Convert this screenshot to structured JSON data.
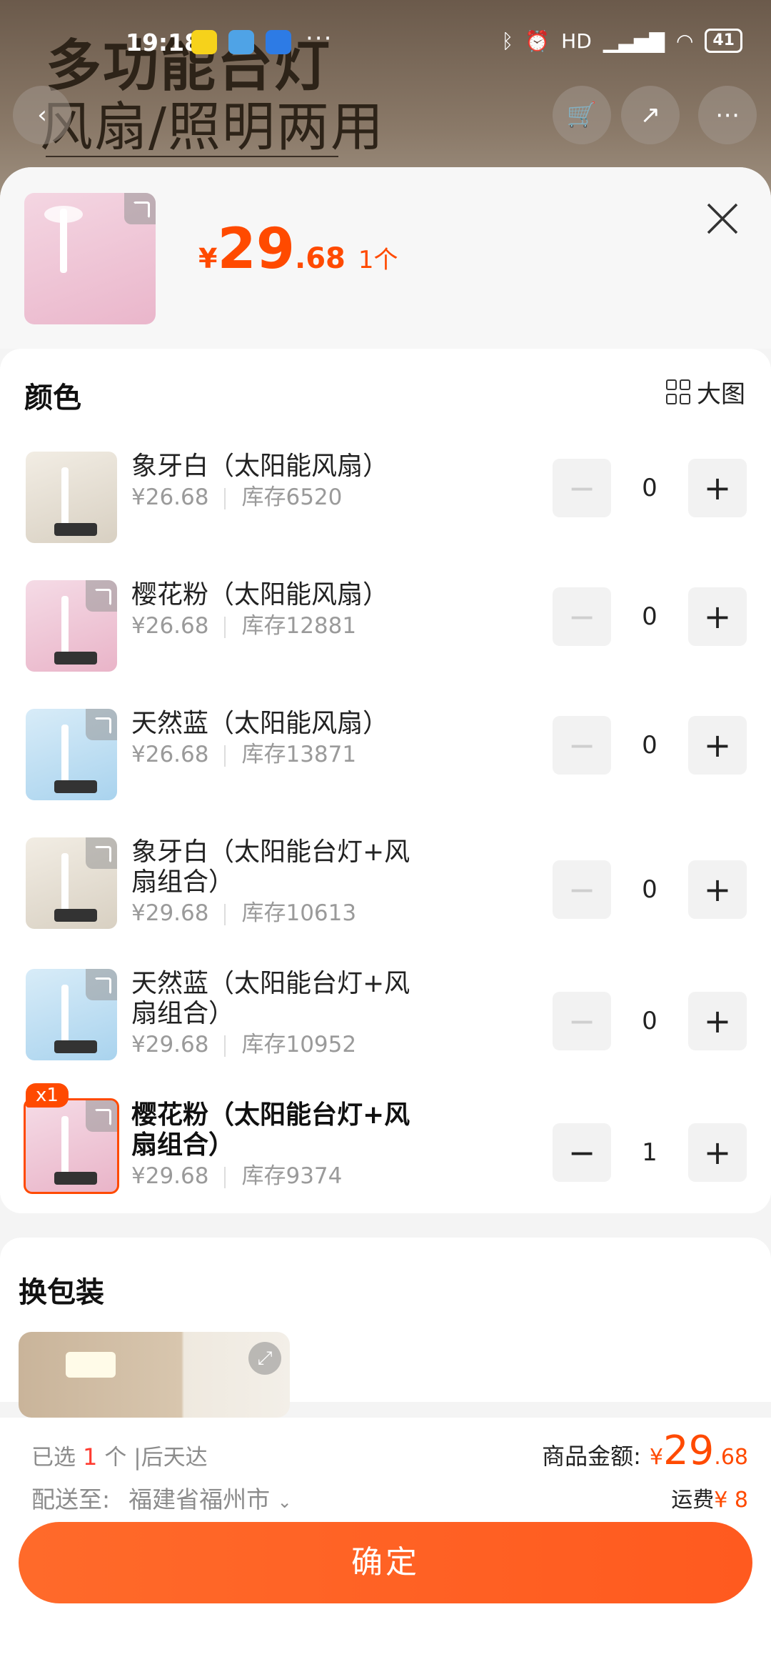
{
  "status_bar": {
    "time": "19:18",
    "more": "···",
    "network": "HD",
    "battery": "41"
  },
  "background": {
    "title_line1": "多功能台灯",
    "title_line2": "风扇/照明两用"
  },
  "header": {
    "price_currency": "¥",
    "price_integer": "29",
    "price_decimal": ".68",
    "quantity": "1个"
  },
  "color_section": {
    "title": "颜色",
    "big_image_label": "大图",
    "items": [
      {
        "name": "象牙白（太阳能风扇）",
        "price": "¥26.68",
        "stock": "库存6520",
        "qty": "0"
      },
      {
        "name": "樱花粉（太阳能风扇）",
        "price": "¥26.68",
        "stock": "库存12881",
        "qty": "0"
      },
      {
        "name": "天然蓝（太阳能风扇）",
        "price": "¥26.68",
        "stock": "库存13871",
        "qty": "0"
      },
      {
        "name": "象牙白（太阳能台灯+风扇组合）",
        "price": "¥29.68",
        "stock": "库存10613",
        "qty": "0"
      },
      {
        "name": "天然蓝（太阳能台灯+风扇组合）",
        "price": "¥29.68",
        "stock": "库存10952",
        "qty": "0"
      },
      {
        "name": "樱花粉（太阳能台灯+风扇组合）",
        "price": "¥29.68",
        "stock": "库存9374",
        "qty": "1",
        "badge": "x1"
      }
    ]
  },
  "package_section": {
    "title": "换包装"
  },
  "footer": {
    "selected_prefix": "已选",
    "selected_count": "1",
    "selected_suffix": "个 |后天达",
    "ship_label": "配送至:",
    "ship_location": "福建省福州市",
    "amount_label": "商品金额:",
    "amount_currency": "¥",
    "amount_integer": "29",
    "amount_decimal": ".68",
    "freight_label": "运费",
    "freight_amount": "¥ 8",
    "confirm_label": "确定"
  },
  "colors": {
    "accent": "#ff4a00",
    "button": "#ff5f24"
  }
}
